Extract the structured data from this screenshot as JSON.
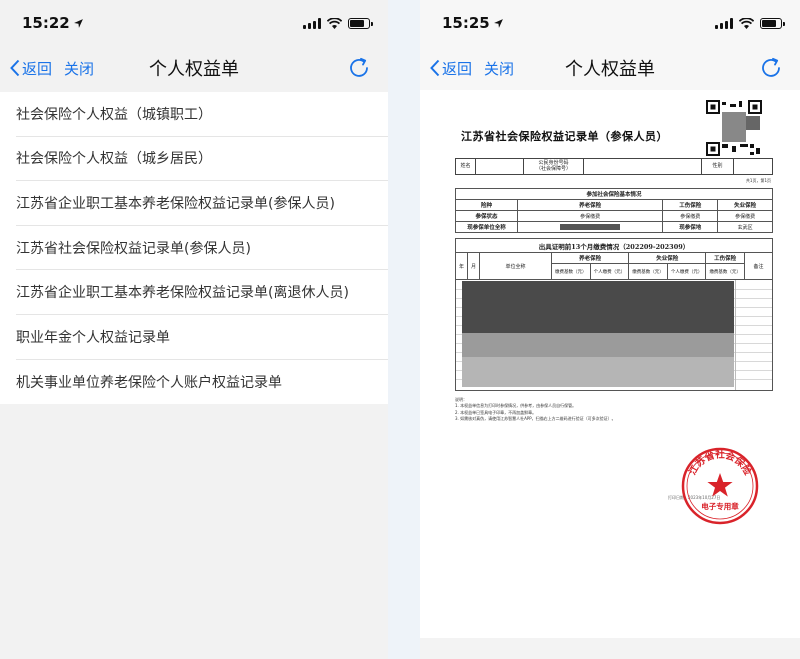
{
  "colors": {
    "accent": "#1a73e8",
    "seal_red": "#d9232a"
  },
  "left_screen": {
    "status": {
      "time": "15:22",
      "battery_level": 0.8
    },
    "nav": {
      "back_label": "返回",
      "close_label": "关闭",
      "title": "个人权益单",
      "refresh_icon": "refresh-icon"
    },
    "items": [
      "社会保险个人权益（城镇职工）",
      "社会保险个人权益（城乡居民）",
      "江苏省企业职工基本养老保险权益记录单(参保人员)",
      "江苏省社会保险权益记录单(参保人员)",
      "江苏省企业职工基本养老保险权益记录单(离退休人员)",
      "职业年金个人权益记录单",
      "机关事业单位养老保险个人账户权益记录单"
    ]
  },
  "right_screen": {
    "status": {
      "time": "15:25",
      "battery_level": 0.8
    },
    "nav": {
      "back_label": "返回",
      "close_label": "关闭",
      "title": "个人权益单",
      "refresh_icon": "refresh-icon"
    },
    "document": {
      "title": "江苏省社会保险权益记录单（参保人员）",
      "name_label": "姓名",
      "id_label_1": "公民身份号码",
      "id_label_2": "（社会保障号）",
      "gender_label": "性别",
      "page_no": "共1页，第1页",
      "basic_header": "参加社会保险基本情况",
      "insurance_type_label": "险种",
      "pension_label": "养老保险",
      "injury_label": "工伤保险",
      "unemployment_label": "失业保险",
      "status_label": "参保状态",
      "paying_status": "参保缴费",
      "employer_label": "现参保单位全称",
      "location_label": "现参保地",
      "location_value": "玄武区",
      "payment_header": "出具证明前13个月缴费情况（202209-202309）",
      "year_label": "年",
      "month_label": "月",
      "unit_label": "单位全称",
      "base_label": "缴费基数（元）",
      "personal_label": "个人缴费（元）",
      "remark_label": "备注",
      "notes": [
        "说明：",
        "1. 本权益单信息为打印时参保情况，供参考，由参保人员自行保管。",
        "2. 本权益单已签具电子印章，不再加盖鲜章。",
        "3. 如需核对真伪，请使用江苏智慧人社APP，扫描右上方二维码进行验证（可多次验证）。"
      ],
      "print_info": "打印日期：2023年10月27日",
      "seal_text": "江苏省社会保险",
      "seal_bottom": "电子专用章"
    }
  }
}
